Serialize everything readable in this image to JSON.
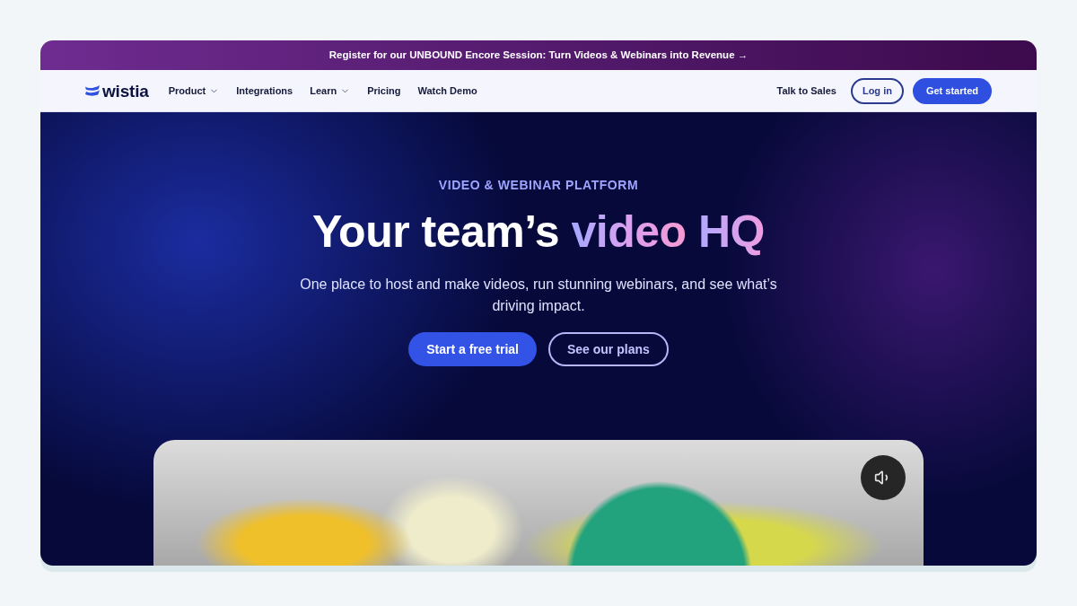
{
  "banner": {
    "text": "Register for our UNBOUND Encore Session: Turn Videos & Webinars into Revenue →"
  },
  "nav": {
    "logo": "wistia",
    "items": [
      {
        "label": "Product",
        "kind": "dropdown"
      },
      {
        "label": "Integrations",
        "kind": "link"
      },
      {
        "label": "Learn",
        "kind": "dropdown"
      },
      {
        "label": "Pricing",
        "kind": "link"
      },
      {
        "label": "Watch Demo",
        "kind": "link"
      }
    ],
    "actions": [
      {
        "label": "Talk to Sales",
        "kind": "link"
      },
      {
        "label": "Log in",
        "kind": "outline"
      },
      {
        "label": "Get started",
        "kind": "primary"
      }
    ]
  },
  "hero": {
    "eyebrow": "VIDEO & WEBINAR PLATFORM",
    "heading": {
      "text": "Your team’s",
      "highlight": [
        "video",
        "HQ"
      ]
    },
    "subtitle": "One place to host and make videos, run stunning webinars, and see what’s driving impact.",
    "buttons": [
      {
        "label": "Start a free trial",
        "kind": "primary"
      },
      {
        "label": "See our plans",
        "kind": "outline"
      }
    ]
  },
  "video": {
    "muted": false
  }
}
